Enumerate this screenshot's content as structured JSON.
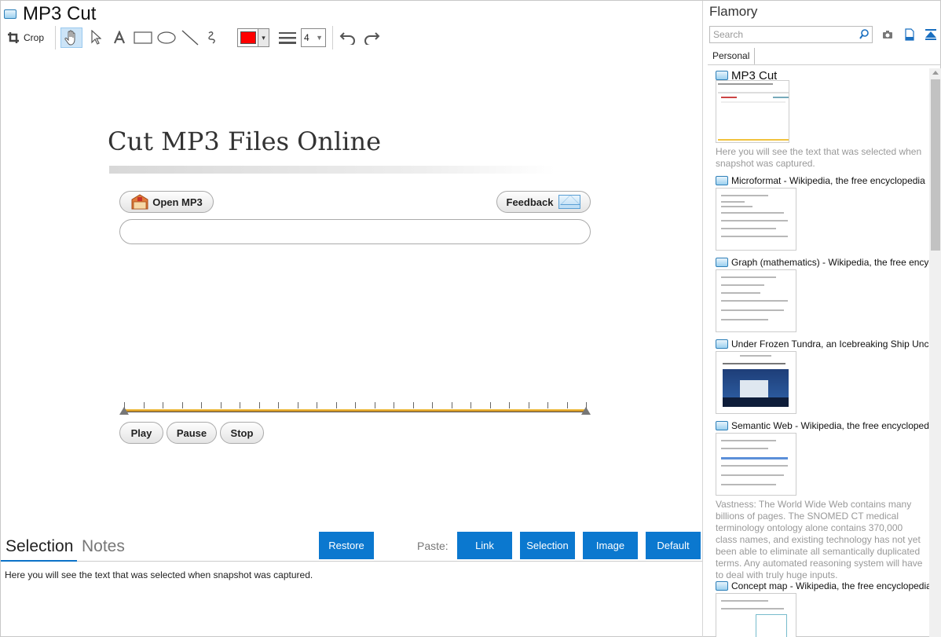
{
  "window": {
    "title": "MP3 Cut"
  },
  "toolbar": {
    "crop_label": "Crop",
    "color": "#ff0000",
    "line_size": "4"
  },
  "captured_page": {
    "heading": "Cut MP3 Files Online",
    "open_button": "Open MP3",
    "feedback_button": "Feedback",
    "play_button": "Play",
    "pause_button": "Pause",
    "stop_button": "Stop"
  },
  "bottom_panel": {
    "tabs": [
      "Selection",
      "Notes"
    ],
    "restore_button": "Restore",
    "paste_label": "Paste:",
    "paste_buttons": [
      "Link",
      "Selection",
      "Image",
      "Default"
    ],
    "selection_text": "Here you will see the text that was selected when snapshot was captured."
  },
  "sidebar": {
    "app_name": "Flamory",
    "search_placeholder": "Search",
    "tab": "Personal",
    "snapshots": [
      {
        "title": "MP3 Cut",
        "description": "Here you will see the text that was selected when snapshot was captured."
      },
      {
        "title": "Microformat - Wikipedia, the free encyclopedia",
        "description": ""
      },
      {
        "title": "Graph (mathematics) - Wikipedia, the free encyclopedia",
        "description": ""
      },
      {
        "title": "Under Frozen Tundra, an Icebreaking Ship Uncovers",
        "description": ""
      },
      {
        "title": "Semantic Web - Wikipedia, the free encyclopedia",
        "description": "Vastness: The World Wide Web contains many billions of pages. The SNOMED CT medical terminology ontology alone contains 370,000 class names, and existing technology has not yet been able to eliminate all semantically duplicated terms. Any automated reasoning system will have to deal with truly huge inputs."
      },
      {
        "title": "Concept map - Wikipedia, the free encyclopedia",
        "description": ""
      }
    ]
  },
  "colors": {
    "accent_blue": "#0b78cf",
    "pen_color": "#ff0000"
  }
}
